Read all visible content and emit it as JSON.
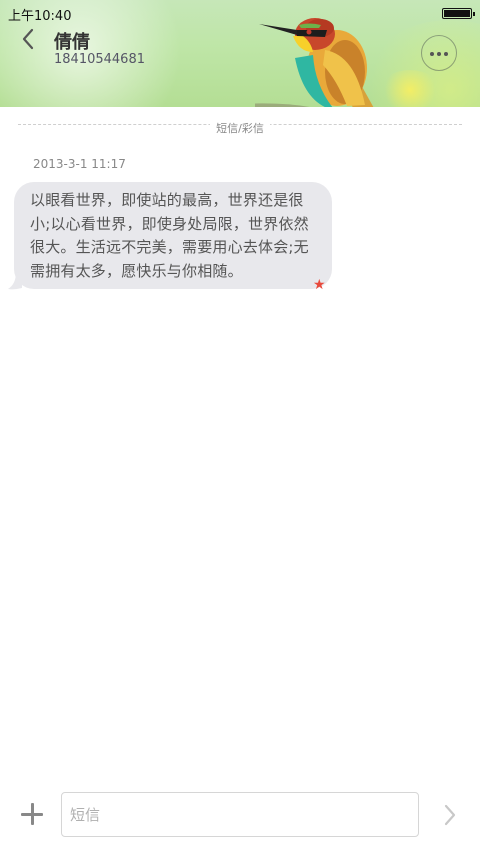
{
  "status_bar": {
    "time": "上午10:40"
  },
  "header": {
    "contact_name": "倩倩",
    "phone_number": "18410544681"
  },
  "conversation": {
    "divider_label": "短信/彩信",
    "message": {
      "timestamp": "2013-3-1 11:17",
      "lines": [
        "以眼看世界，即使站的最高，世界还是很",
        "小;以心看世界，即使身处局限，世界依然",
        "很大。生活远不完美，需要用心去体会;无",
        "需拥有太多，愿快乐与你相随。"
      ],
      "starred": true
    }
  },
  "composer": {
    "placeholder": "短信"
  },
  "colors": {
    "accent_star": "#e84a3c",
    "bubble": "#e8e8ec"
  },
  "icons": [
    "back-chevron-icon",
    "more-options-icon",
    "star-icon",
    "add-icon",
    "send-icon",
    "battery-icon"
  ]
}
